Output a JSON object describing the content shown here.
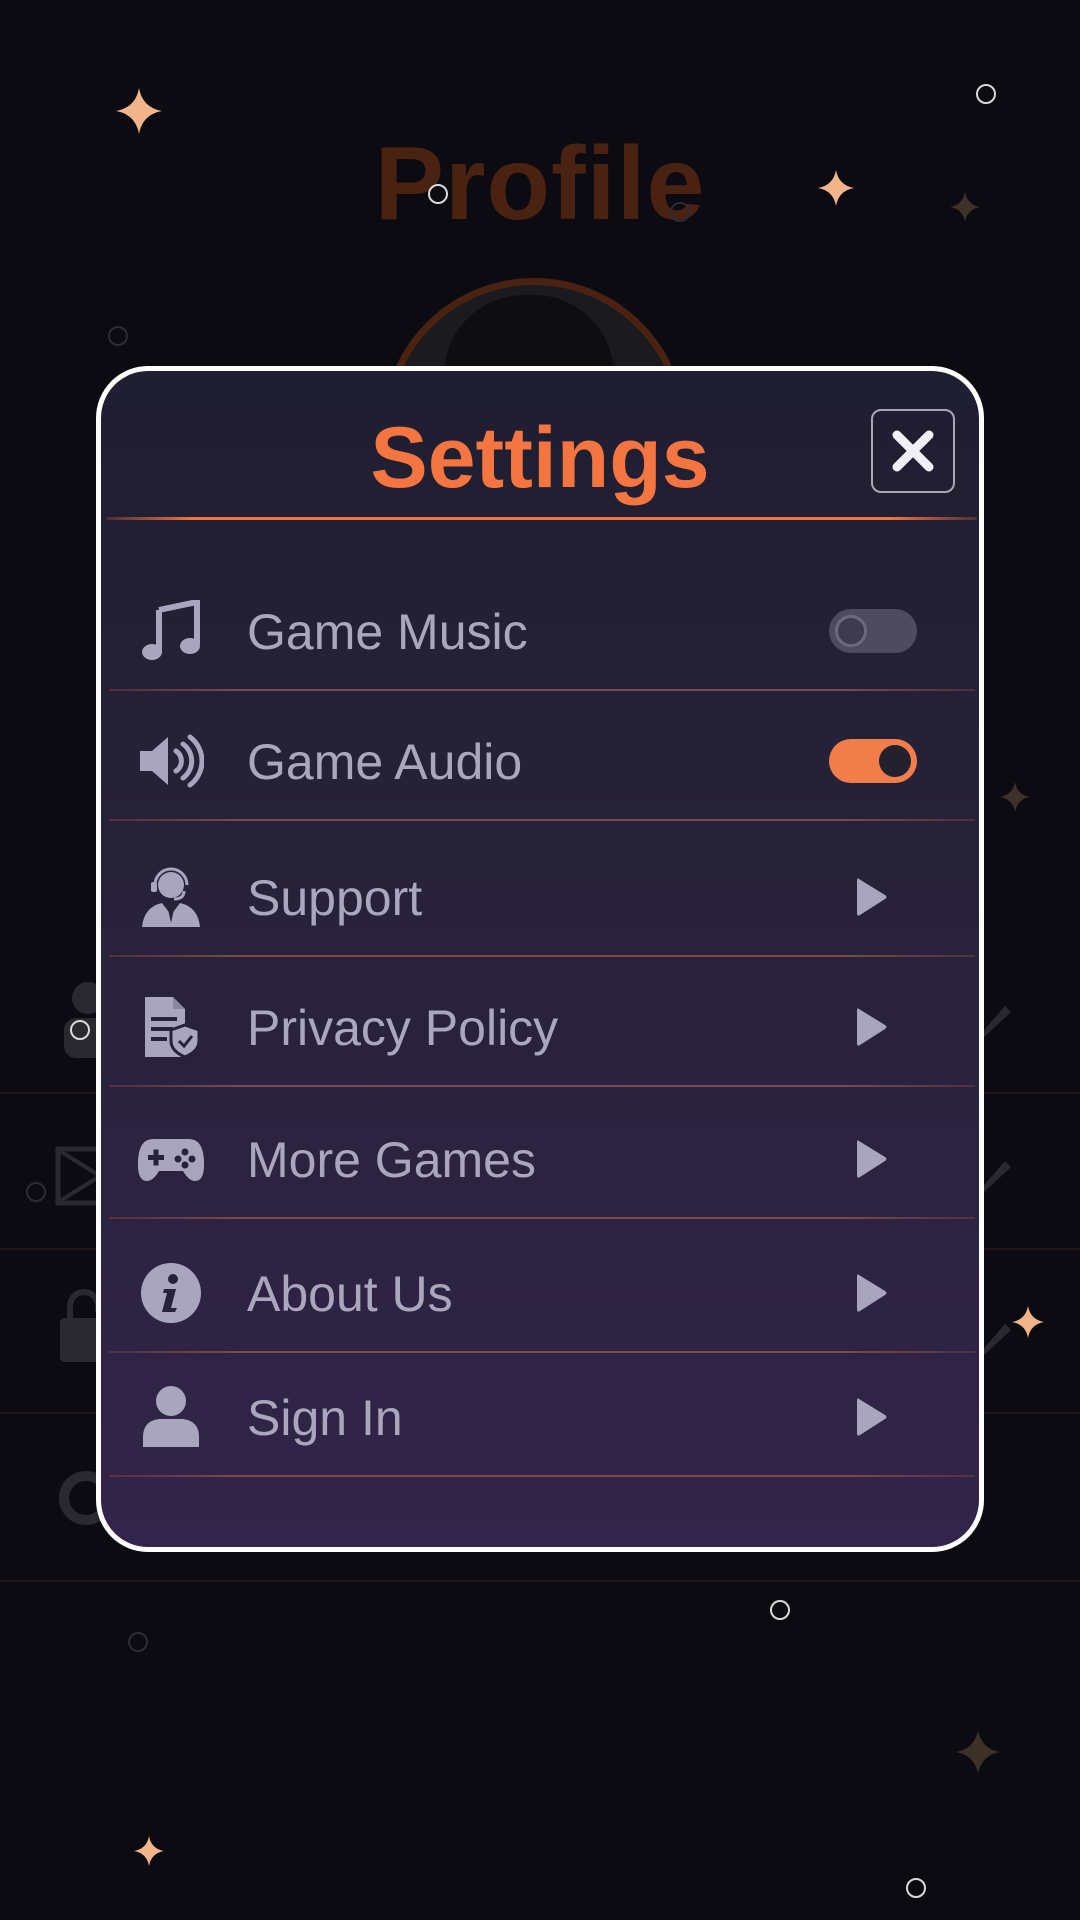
{
  "background": {
    "page_title": "Profile"
  },
  "settings": {
    "title": "Settings",
    "close_icon": "close-icon",
    "items": [
      {
        "label": "Game Music",
        "icon": "music-note-icon",
        "control": "toggle",
        "toggle_on": false
      },
      {
        "label": "Game Audio",
        "icon": "speaker-icon",
        "control": "toggle",
        "toggle_on": true
      },
      {
        "label": "Support",
        "icon": "support-agent-icon",
        "control": "arrow"
      },
      {
        "label": "Privacy Policy",
        "icon": "privacy-document-icon",
        "control": "arrow"
      },
      {
        "label": "More Games",
        "icon": "gamepad-icon",
        "control": "arrow"
      },
      {
        "label": "About Us",
        "icon": "info-icon",
        "control": "arrow"
      },
      {
        "label": "Sign In",
        "icon": "user-icon",
        "control": "arrow"
      }
    ]
  },
  "colors": {
    "accent": "#f47540",
    "toggle_on": "#f07d4a",
    "toggle_off": "#4e4a60",
    "label": "#aaa6be",
    "modal_border": "#ffffff"
  }
}
